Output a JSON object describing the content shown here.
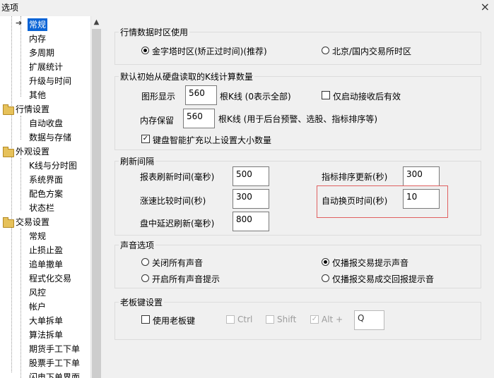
{
  "window": {
    "title": "选项",
    "close_glyph": "×"
  },
  "tree": {
    "items": [
      {
        "label": "常规",
        "selected": true
      },
      {
        "label": "内存"
      },
      {
        "label": "多周期"
      },
      {
        "label": "扩展统计"
      },
      {
        "label": "升级与时间"
      },
      {
        "label": "其他"
      },
      {
        "label": "行情设置",
        "folder": true
      },
      {
        "label": "自动收盘"
      },
      {
        "label": "数据与存储"
      },
      {
        "label": "外观设置",
        "folder": true
      },
      {
        "label": "K线与分时图"
      },
      {
        "label": "系统界面"
      },
      {
        "label": "配色方案"
      },
      {
        "label": "状态栏"
      },
      {
        "label": "交易设置",
        "folder": true
      },
      {
        "label": "常规"
      },
      {
        "label": "止损止盈"
      },
      {
        "label": "追单撤单"
      },
      {
        "label": "程式化交易"
      },
      {
        "label": "风控"
      },
      {
        "label": "帐户"
      },
      {
        "label": "大单拆单"
      },
      {
        "label": "算法拆单"
      },
      {
        "label": "期货手工下单"
      },
      {
        "label": "股票手工下单"
      },
      {
        "label": "闪电下单界面"
      }
    ],
    "scroll_up_glyph": "▲"
  },
  "timezone": {
    "title": "行情数据时区使用",
    "option_jinzita": "金字塔时区(矫正过时间)(推荐)",
    "option_beijing": "北京/国内交易所时区"
  },
  "kline": {
    "title": "默认初始从硬盘读取的K线计算数量",
    "graph_label": "图形显示",
    "graph_value": "560",
    "graph_unit": "根K线 (0表示全部)",
    "auto_after_recv_label": "仅启动接收后有效",
    "mem_label": "内存保留",
    "mem_value": "560",
    "mem_unit": "根K线 (用于后台预警、选股、指标排序等)",
    "smart_expand_label": "键盘智能扩充以上设置大小数量"
  },
  "refresh": {
    "title": "刷新间隔",
    "report_label": "报表刷新时间(毫秒)",
    "report_value": "500",
    "indicator_label": "指标排序更新(秒)",
    "indicator_value": "300",
    "rise_label": "涨速比较时间(秒)",
    "rise_value": "300",
    "autopage_label": "自动换页时间(秒)",
    "autopage_value": "10",
    "delay_label": "盘中延迟刷新(毫秒)",
    "delay_value": "800"
  },
  "sound": {
    "title": "声音选项",
    "off_all": "关闭所有声音",
    "on_all": "开启所有声音提示",
    "trade_only": "仅播报交易提示声音",
    "trade_fill_only": "仅播报交易成交回报提示音"
  },
  "bosskey": {
    "title": "老板键设置",
    "use_label": "使用老板键",
    "ctrl_label": "Ctrl",
    "shift_label": "Shift",
    "alt_label": "Alt +",
    "key_value": "Q"
  }
}
